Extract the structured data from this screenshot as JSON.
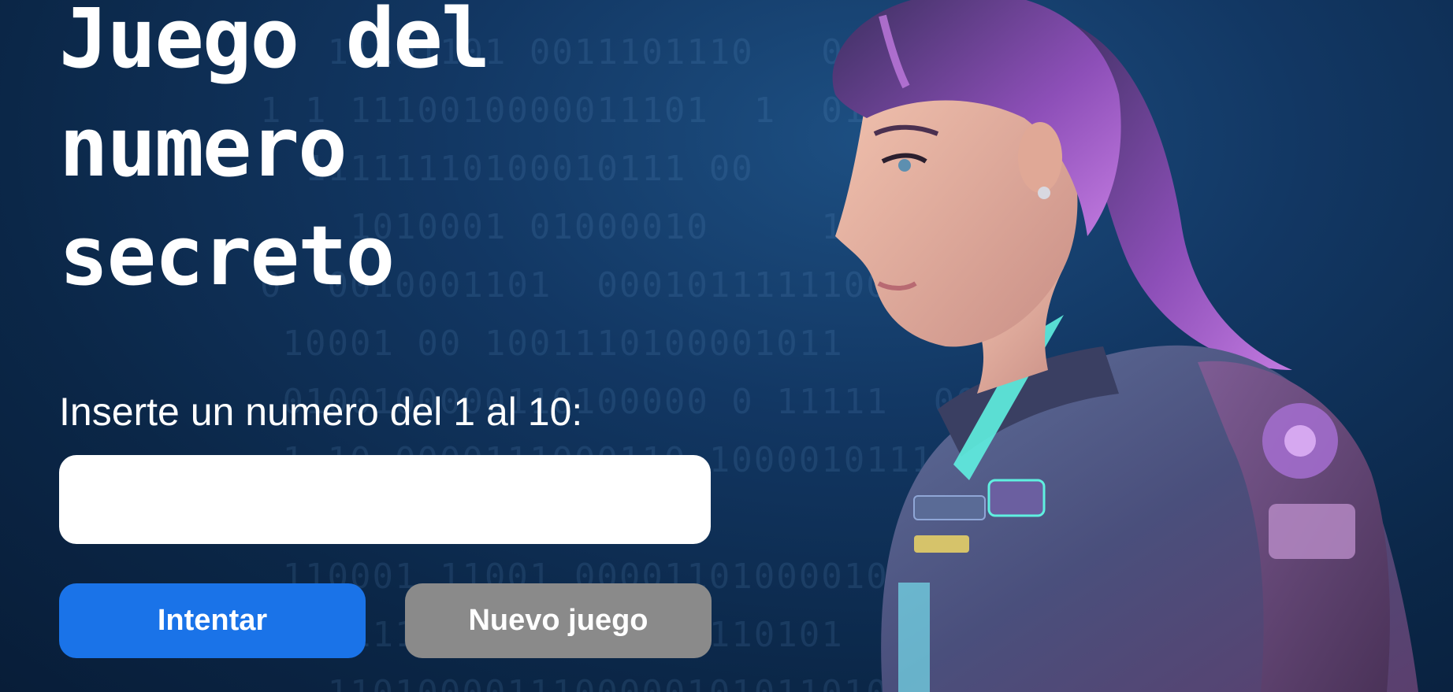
{
  "title": "Juego del numero secreto",
  "input": {
    "label": "Inserte un numero del 1 al 10:",
    "value": "",
    "placeholder": ""
  },
  "buttons": {
    "try_label": "Intentar",
    "new_game_label": "Nuevo juego"
  },
  "colors": {
    "background": "#123763",
    "try_button": "#1a73e8",
    "new_game_button": "#8a8a8a"
  }
}
